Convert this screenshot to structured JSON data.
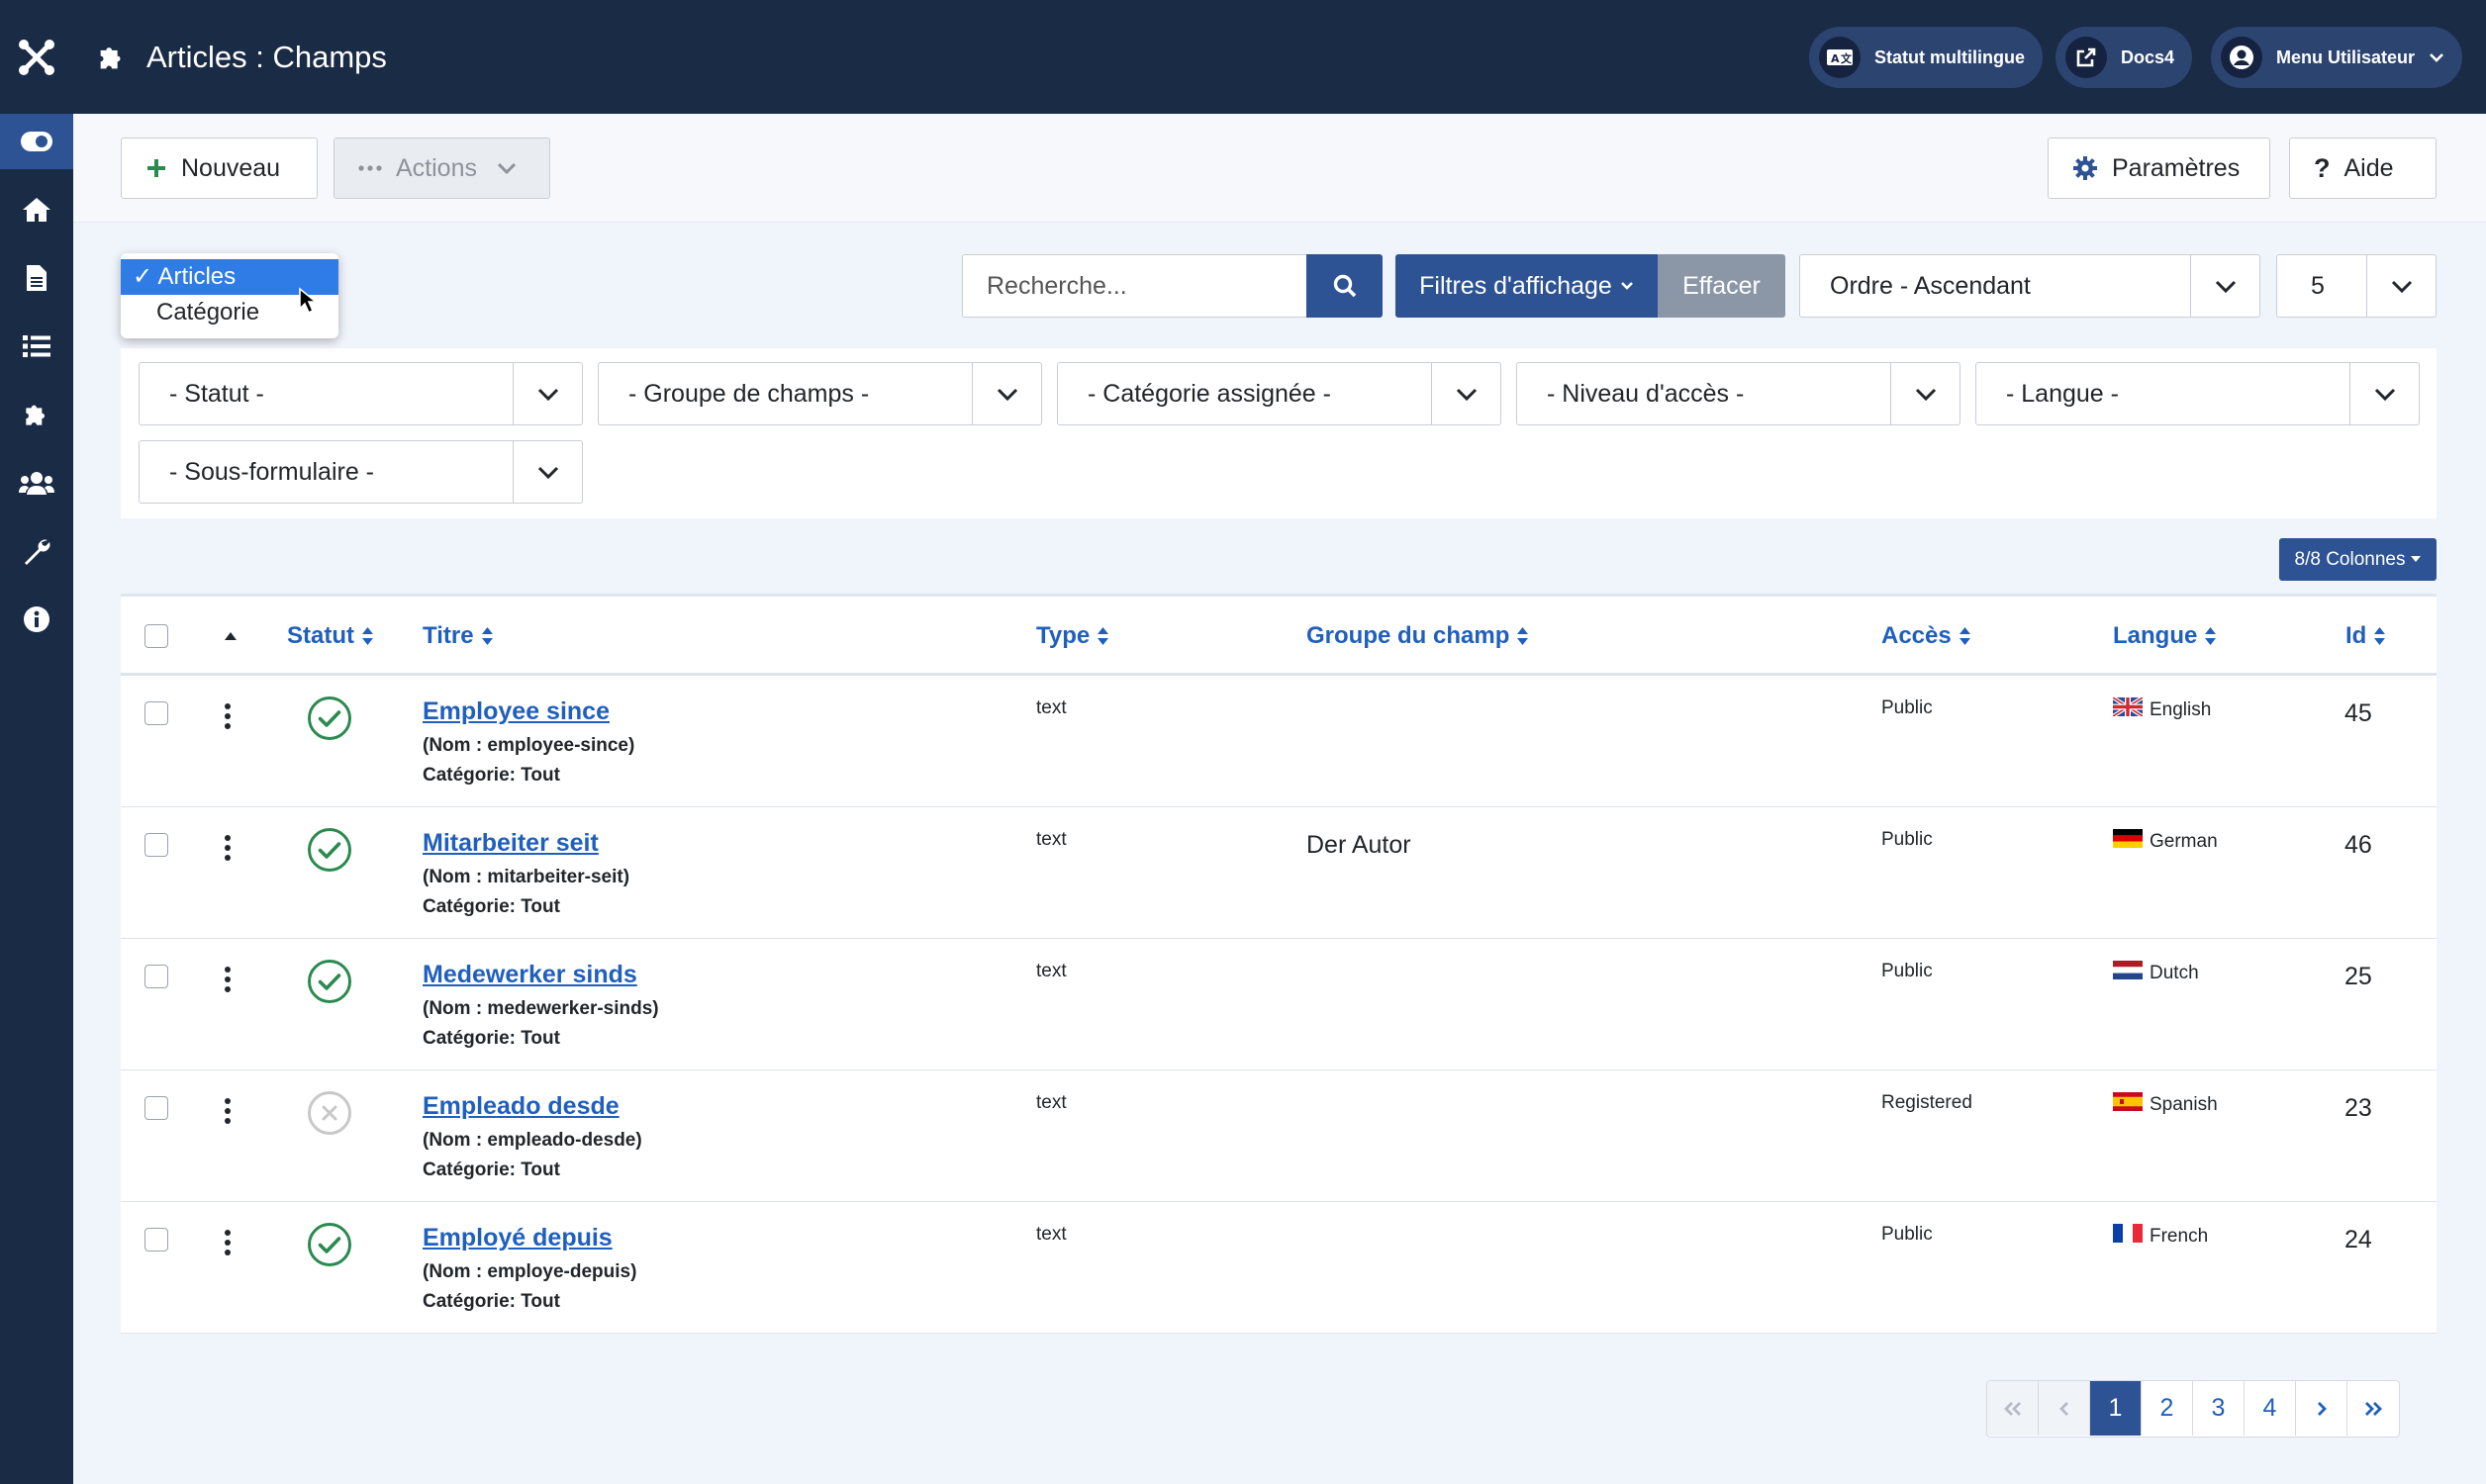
{
  "header": {
    "title": "Articles : Champs",
    "multilingual_label": "Statut multilingue",
    "docs_label": "Docs4",
    "user_menu_label": "Menu Utilisateur"
  },
  "sidebar": {
    "items": [
      {
        "icon": "toggle-icon",
        "active": true
      },
      {
        "icon": "home-icon"
      },
      {
        "icon": "document-icon"
      },
      {
        "icon": "list-icon"
      },
      {
        "icon": "puzzle-icon"
      },
      {
        "icon": "users-icon"
      },
      {
        "icon": "wrench-icon"
      },
      {
        "icon": "info-icon"
      }
    ]
  },
  "toolbar": {
    "new_label": "Nouveau",
    "actions_label": "Actions",
    "options_label": "Paramètres",
    "help_label": "Aide"
  },
  "context_dropdown": {
    "selected": "Articles",
    "options": [
      "Articles",
      "Catégorie"
    ]
  },
  "search": {
    "placeholder": "Recherche...",
    "filter_options_label": "Filtres d'affichage",
    "clear_label": "Effacer",
    "ordering_value": "Ordre - Ascendant",
    "limit_value": "5"
  },
  "filters": {
    "status": "- Statut -",
    "field_group": "- Groupe de champs -",
    "assigned_category": "- Catégorie assignée -",
    "access_level": "- Niveau d'accès -",
    "language": "- Langue -",
    "subform": "- Sous-formulaire -"
  },
  "columns_button_label": "8/8 Colonnes",
  "table": {
    "headers": {
      "status": "Statut",
      "title": "Titre",
      "type": "Type",
      "group": "Groupe du champ",
      "access": "Accès",
      "language": "Langue",
      "id": "Id"
    },
    "rows": [
      {
        "published": true,
        "title": "Employee since",
        "name": "(Nom : employee-since)",
        "category": "Catégorie: Tout",
        "type": "text",
        "group": "",
        "access": "Public",
        "flag": "uk",
        "language": "English",
        "id": "45"
      },
      {
        "published": true,
        "title": "Mitarbeiter seit",
        "name": "(Nom : mitarbeiter-seit)",
        "category": "Catégorie: Tout",
        "type": "text",
        "group": "Der Autor",
        "access": "Public",
        "flag": "de",
        "language": "German",
        "id": "46"
      },
      {
        "published": true,
        "title": "Medewerker sinds",
        "name": "(Nom : medewerker-sinds)",
        "category": "Catégorie: Tout",
        "type": "text",
        "group": "",
        "access": "Public",
        "flag": "nl",
        "language": "Dutch",
        "id": "25"
      },
      {
        "published": false,
        "title": "Empleado desde",
        "name": "(Nom : empleado-desde)",
        "category": "Catégorie: Tout",
        "type": "text",
        "group": "",
        "access": "Registered",
        "flag": "es",
        "language": "Spanish",
        "id": "23"
      },
      {
        "published": true,
        "title": "Employé depuis",
        "name": "(Nom : employe-depuis)",
        "category": "Catégorie: Tout",
        "type": "text",
        "group": "",
        "access": "Public",
        "flag": "fr",
        "language": "French",
        "id": "24"
      }
    ]
  },
  "pagination": {
    "pages": [
      "1",
      "2",
      "3",
      "4"
    ],
    "current": "1"
  },
  "colors": {
    "header_bg": "#1a2b46",
    "primary": "#2d5394",
    "link": "#1f5fbd",
    "published": "#2a8a4f",
    "unpublished": "#c8c8c8"
  }
}
